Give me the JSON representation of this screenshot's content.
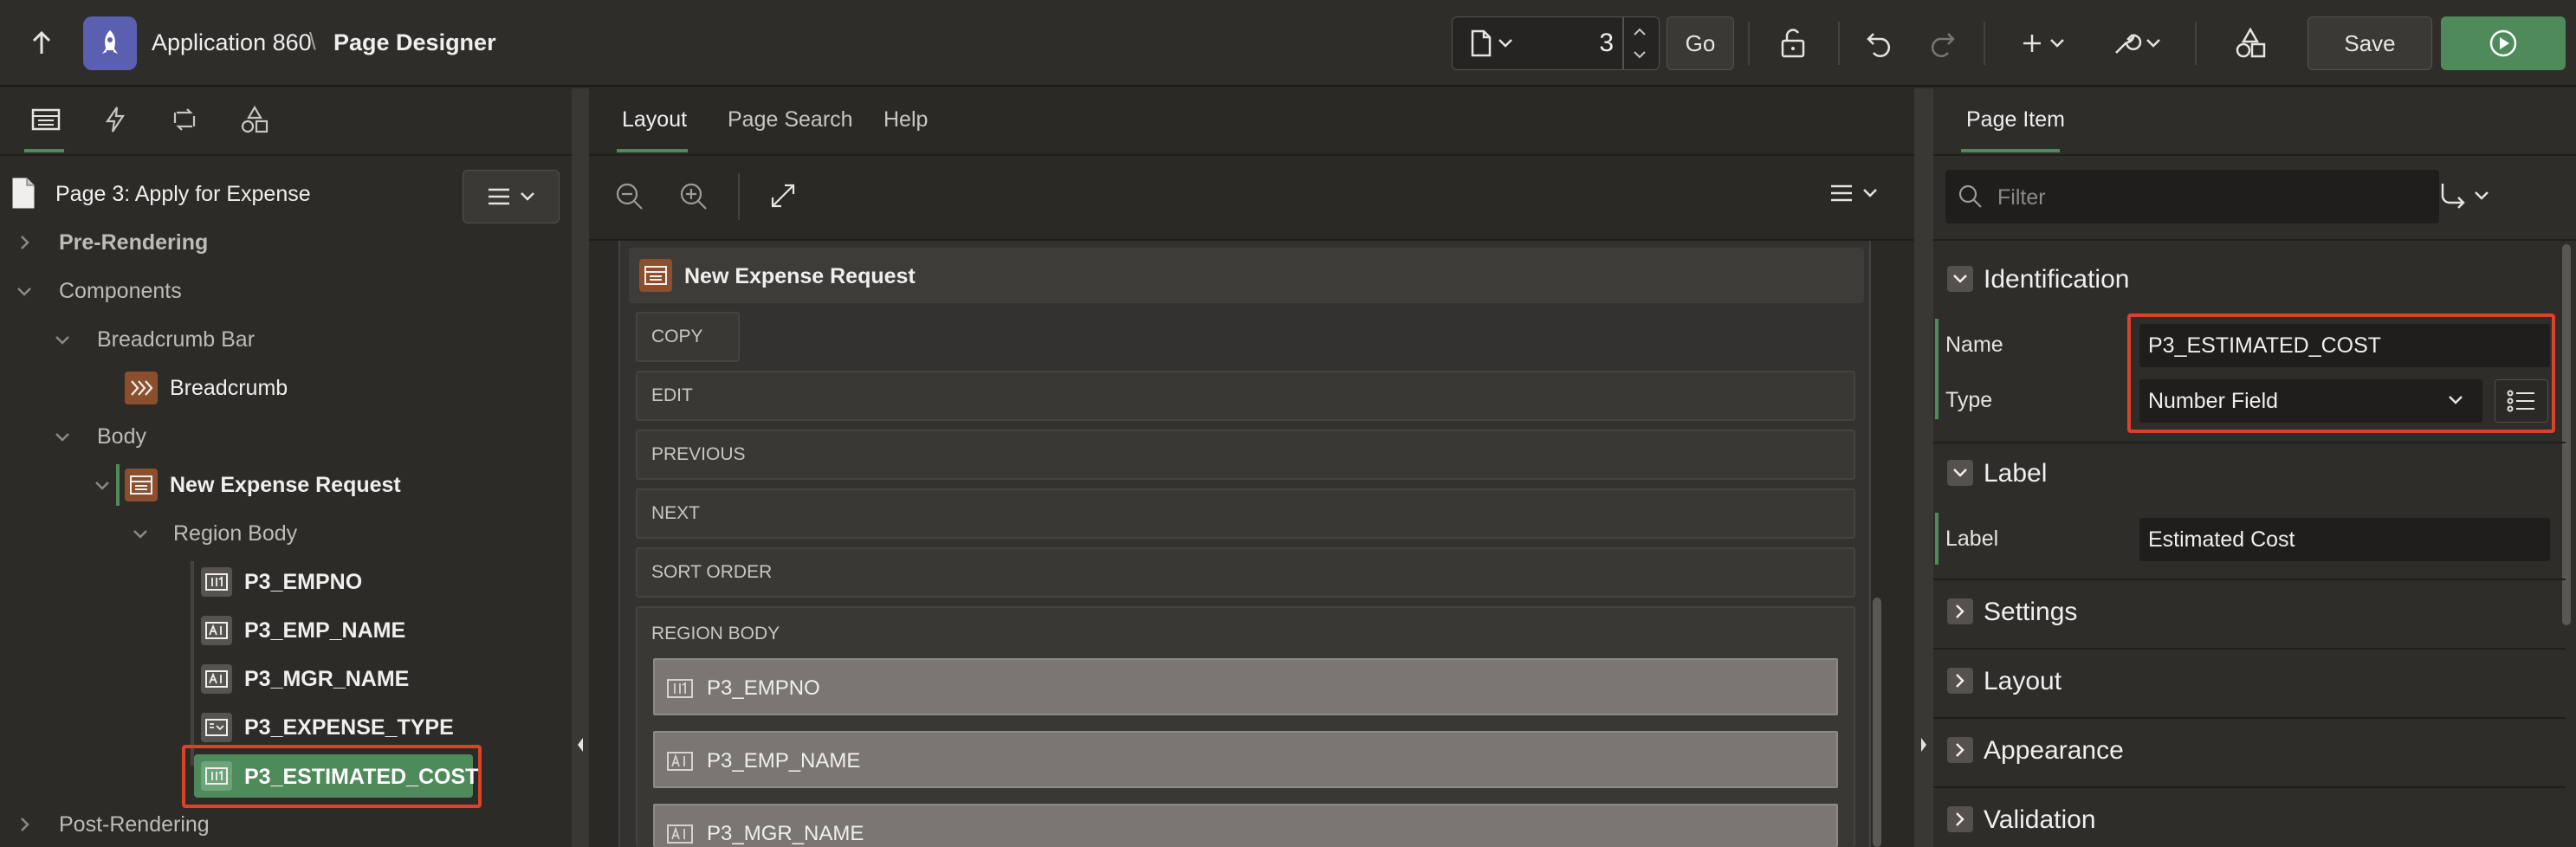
{
  "header": {
    "app_name": "Application 860",
    "separator": "\\",
    "page_title": "Page Designer",
    "page_number": "3",
    "go_label": "Go",
    "save_label": "Save"
  },
  "left_panel": {
    "page_label": "Page 3: Apply for Expense",
    "tree": {
      "pre_rendering": "Pre-Rendering",
      "components": "Components",
      "breadcrumb_bar": "Breadcrumb Bar",
      "breadcrumb": "Breadcrumb",
      "body": "Body",
      "region": "New Expense Request",
      "region_body": "Region Body",
      "items": [
        "P3_EMPNO",
        "P3_EMP_NAME",
        "P3_MGR_NAME",
        "P3_EXPENSE_TYPE",
        "P3_ESTIMATED_COST"
      ],
      "post_rendering": "Post-Rendering"
    }
  },
  "middle_panel": {
    "tabs": [
      "Layout",
      "Page Search",
      "Help"
    ],
    "region_title": "New Expense Request",
    "positions": [
      "COPY",
      "EDIT",
      "PREVIOUS",
      "NEXT",
      "SORT ORDER",
      "REGION BODY"
    ],
    "items": [
      "P3_EMPNO",
      "P3_EMP_NAME",
      "P3_MGR_NAME"
    ]
  },
  "right_panel": {
    "tab": "Page Item",
    "filter_placeholder": "Filter",
    "sections": {
      "identification": "Identification",
      "label": "Label",
      "settings": "Settings",
      "layout": "Layout",
      "appearance": "Appearance",
      "validation": "Validation"
    },
    "props": {
      "name_label": "Name",
      "name_value": "P3_ESTIMATED_COST",
      "type_label": "Type",
      "type_value": "Number Field",
      "label_label": "Label",
      "label_value": "Estimated Cost"
    }
  },
  "colors": {
    "accent_green": "#4f8a5b",
    "highlight_red": "#d9432c",
    "background": "#2b2926"
  }
}
